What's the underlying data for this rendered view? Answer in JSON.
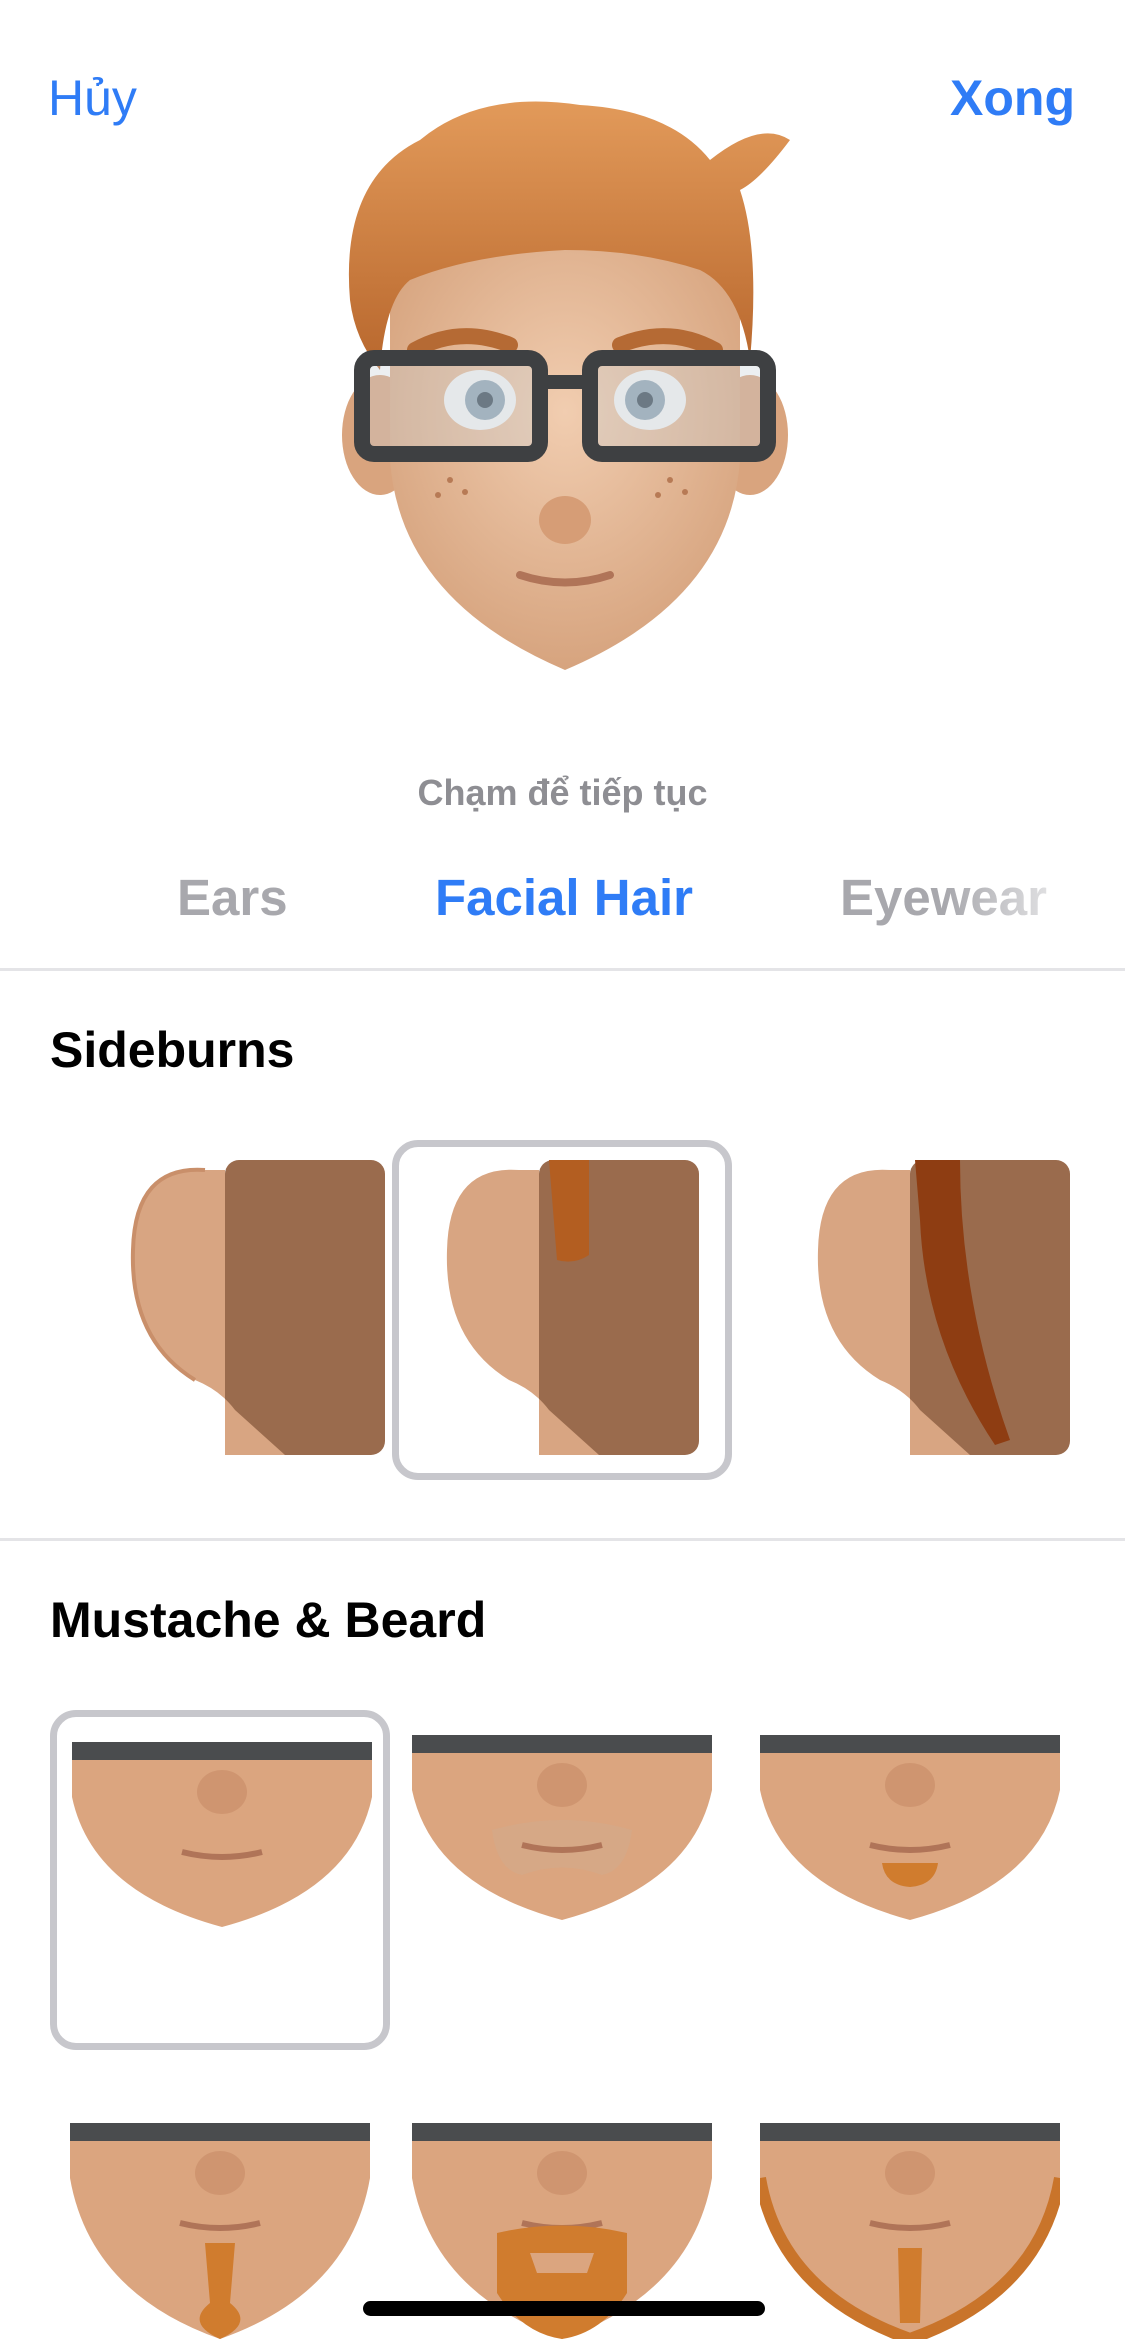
{
  "header": {
    "cancel_label": "Hủy",
    "done_label": "Xong"
  },
  "avatar": {
    "name": "memoji-preview"
  },
  "hint": "Chạm để tiếp tục",
  "categories": [
    {
      "label": "Ears",
      "selected": false
    },
    {
      "label": "Facial Hair",
      "selected": true
    },
    {
      "label": "Eyewear",
      "selected": false
    }
  ],
  "sections": {
    "sideburns": {
      "title": "Sideburns",
      "selected_index": 1
    },
    "beard": {
      "title": "Mustache & Beard",
      "selected_index": 0
    }
  },
  "colors": {
    "accent": "#2f7cf6",
    "hair": "#c9733a",
    "skin": "#dca883",
    "selection_border": "#c7c7cc"
  }
}
